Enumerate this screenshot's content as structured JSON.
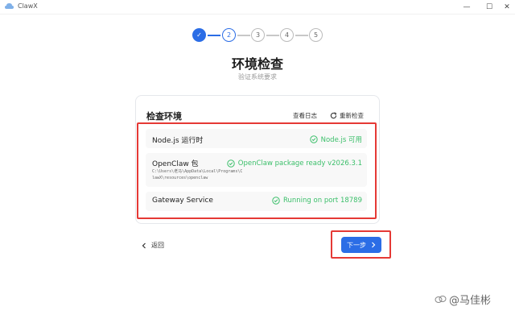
{
  "window": {
    "title": "ClawX",
    "minimize_glyph": "—",
    "maximize_glyph": "☐",
    "close_glyph": "✕"
  },
  "stepper": {
    "steps": [
      {
        "label": "✓",
        "state": "done"
      },
      {
        "label": "2",
        "state": "current"
      },
      {
        "label": "3",
        "state": "todo"
      },
      {
        "label": "4",
        "state": "todo"
      },
      {
        "label": "5",
        "state": "todo"
      }
    ]
  },
  "header": {
    "title": "环境检查",
    "subtitle": "验证系统要求"
  },
  "card": {
    "title": "检查环境",
    "view_log_label": "查看日志",
    "recheck_label": "重新检查",
    "rows": [
      {
        "label": "Node.js 运行时",
        "path": "",
        "status": "Node.js 可用"
      },
      {
        "label": "OpenClaw 包",
        "path": "C:\\Users\\老马\\AppData\\Local\\Programs\\ClawX\\resources\\openclaw",
        "status": "OpenClaw package ready v2026.3.1"
      },
      {
        "label": "Gateway Service",
        "path": "",
        "status": "Running on port 18789"
      }
    ]
  },
  "footer": {
    "back_label": "返回",
    "next_label": "下一步"
  },
  "watermark": {
    "text": "@马佳彬"
  },
  "colors": {
    "accent": "#2b6de6",
    "success": "#3bbf6a",
    "annotation": "#e53935"
  }
}
